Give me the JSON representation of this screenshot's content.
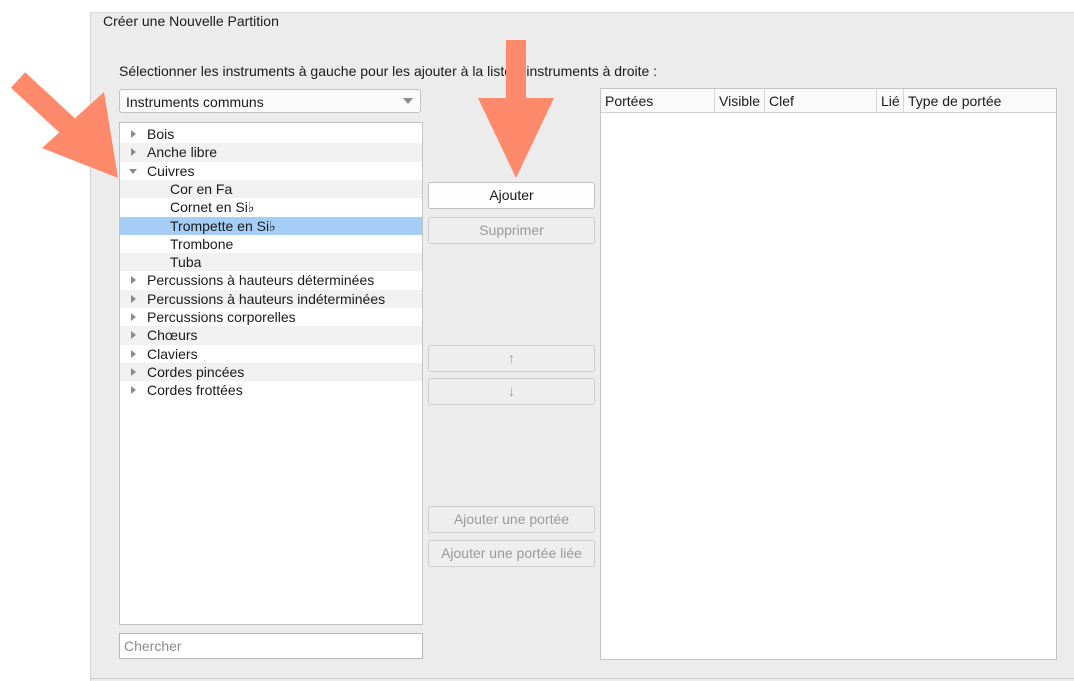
{
  "window": {
    "title": "Créer une Nouvelle Partition"
  },
  "instructions": "Sélectionner les instruments à gauche pour les ajouter à la liste d'instruments à droite :",
  "family_select": {
    "value": "Instruments communs"
  },
  "tree": [
    {
      "label": "Bois",
      "level": 0,
      "state": "closed"
    },
    {
      "label": "Anche libre",
      "level": 0,
      "state": "closed"
    },
    {
      "label": "Cuivres",
      "level": 0,
      "state": "open"
    },
    {
      "label": "Cor en Fa",
      "level": 1
    },
    {
      "label": "Cornet en Si♭",
      "level": 1
    },
    {
      "label": "Trompette en Si♭",
      "level": 1,
      "selected": true
    },
    {
      "label": "Trombone",
      "level": 1
    },
    {
      "label": "Tuba",
      "level": 1
    },
    {
      "label": "Percussions à hauteurs déterminées",
      "level": 0,
      "state": "closed"
    },
    {
      "label": "Percussions à hauteurs indéterminées",
      "level": 0,
      "state": "closed"
    },
    {
      "label": "Percussions corporelles",
      "level": 0,
      "state": "closed"
    },
    {
      "label": "Chœurs",
      "level": 0,
      "state": "closed"
    },
    {
      "label": "Claviers",
      "level": 0,
      "state": "closed"
    },
    {
      "label": "Cordes pincées",
      "level": 0,
      "state": "closed"
    },
    {
      "label": "Cordes frottées",
      "level": 0,
      "state": "closed"
    }
  ],
  "search": {
    "placeholder": "Chercher",
    "value": ""
  },
  "buttons": {
    "add": "Ajouter",
    "remove": "Supprimer",
    "up": "↑",
    "down": "↓",
    "add_staff": "Ajouter une portée",
    "add_linked_staff": "Ajouter une portée liée"
  },
  "staff_table": {
    "columns": [
      "Portées",
      "Visible",
      "Clef",
      "Lié",
      "Type de portée"
    ]
  },
  "colors": {
    "selection": "#a6cdf5",
    "annotation_arrow": "#ff8a6b"
  },
  "icons": {
    "tree_closed": "triangle-right-icon",
    "tree_open": "triangle-down-icon",
    "select_arrow": "chevron-down-icon"
  }
}
